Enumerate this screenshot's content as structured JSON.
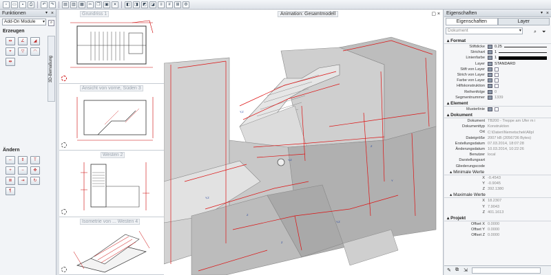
{
  "left_panel": {
    "title": "Funktionen",
    "module_select": "Add-On Module",
    "section_create": "Erzeugen",
    "section_change": "Ändern",
    "side_tab": "3D-Bemaßung"
  },
  "views": [
    {
      "title": "Grundriss 1"
    },
    {
      "title": "Ansicht von vorne, Süden 3"
    },
    {
      "title": "Westen 2"
    },
    {
      "title": "Isometrie von ... Westen 4"
    }
  ],
  "main_view": {
    "title": "Animation: Gesamtmodell"
  },
  "properties": {
    "title": "Eigenschaften",
    "tabs": [
      "Eigenschaften",
      "Layer"
    ],
    "doc_select": "Dokument",
    "sections": [
      {
        "name": "Format",
        "rows": [
          {
            "label": "Stiftdicke",
            "value": "0.25"
          },
          {
            "label": "Strichart",
            "value": "1"
          },
          {
            "label": "Linienfarbe",
            "value": "1"
          },
          {
            "label": "Layer",
            "value": "STANDARD"
          },
          {
            "label": "Stift von Layer",
            "value": ""
          },
          {
            "label": "Strich von Layer",
            "value": ""
          },
          {
            "label": "Farbe von Layer",
            "value": ""
          },
          {
            "label": "Hilfskonstruktion",
            "value": ""
          },
          {
            "label": "Reihenfolge",
            "value": "0"
          },
          {
            "label": "Segmentnummer",
            "value": "1339"
          }
        ]
      },
      {
        "name": "Element",
        "rows": [
          {
            "label": "Musterlinie",
            "value": ""
          }
        ]
      },
      {
        "name": "Dokument",
        "rows": [
          {
            "label": "Dokument",
            "value": "TB200 - Treppe am Ufer m i"
          },
          {
            "label": "Dokumenttyp",
            "value": "Konstruktion"
          },
          {
            "label": "Ort",
            "value": "C:\\Daten\\Nemetschek\\Allpl"
          },
          {
            "label": "Dateigröße",
            "value": "2007 kB (2056736 Bytes)"
          },
          {
            "label": "Erstellungsdatum",
            "value": "07.03.2014, 18:07:28"
          },
          {
            "label": "Änderungsdatum",
            "value": "10.03.2014, 10:22:26"
          },
          {
            "label": "Benutzer",
            "value": "local"
          },
          {
            "label": "Darstellungsart",
            "value": ""
          },
          {
            "label": "Gliederungscode",
            "value": ""
          }
        ]
      },
      {
        "name": "Minimale Werte",
        "rows": [
          {
            "label": "X",
            "value": "-0.4543"
          },
          {
            "label": "Y",
            "value": "-0.9045"
          },
          {
            "label": "Z",
            "value": "392.1380"
          }
        ]
      },
      {
        "name": "Maximale Werte",
        "rows": [
          {
            "label": "X",
            "value": "18.2307"
          },
          {
            "label": "Y",
            "value": "7.9043"
          },
          {
            "label": "Z",
            "value": "401.1613"
          }
        ]
      },
      {
        "name": "Projekt",
        "rows": [
          {
            "label": "Offset X",
            "value": "0.0000"
          },
          {
            "label": "Offset Y",
            "value": "0.0000"
          },
          {
            "label": "Offset Z",
            "value": "0.0000"
          }
        ]
      }
    ]
  }
}
